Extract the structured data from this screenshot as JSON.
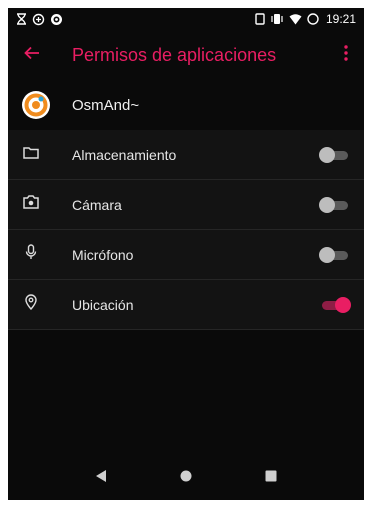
{
  "status_bar": {
    "time": "19:21",
    "left_icons": [
      "hourglass-icon",
      "data-saver-icon",
      "accessibility-icon"
    ],
    "right_icons": [
      "screenshot-icon",
      "vibrate-icon",
      "wifi-icon",
      "battery-icon"
    ]
  },
  "app_bar": {
    "title": "Permisos de aplicaciones",
    "back_icon": "arrow-back-icon",
    "menu_icon": "more-vert-icon",
    "accent": "#e91e63"
  },
  "app": {
    "name": "OsmAnd~",
    "icon": "osmand-logo-icon"
  },
  "permissions": [
    {
      "label": "Almacenamiento",
      "icon": "folder-icon",
      "enabled": false
    },
    {
      "label": "Cámara",
      "icon": "camera-icon",
      "enabled": false
    },
    {
      "label": "Micrófono",
      "icon": "microphone-icon",
      "enabled": false
    },
    {
      "label": "Ubicación",
      "icon": "location-icon",
      "enabled": true
    }
  ],
  "nav_bar": {
    "items": [
      "back-triangle-icon",
      "home-circle-icon",
      "recents-square-icon"
    ]
  }
}
